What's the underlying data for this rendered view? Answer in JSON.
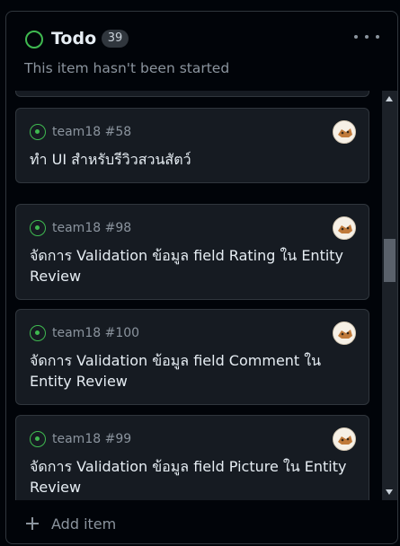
{
  "column": {
    "title": "Todo",
    "count": "39",
    "subtitle": "This item hasn't been started"
  },
  "cards": [
    {
      "meta": "team18 #58",
      "title": "ทำ UI สำหรับรีวิวสวนสัตว์"
    },
    {
      "meta": "team18 #98",
      "title": "จัดการ Validation ข้อมูล field Rating ใน Entity Review"
    },
    {
      "meta": "team18 #100",
      "title": "จัดการ Validation ข้อมูล field Comment ใน Entity Review"
    },
    {
      "meta": "team18 #99",
      "title": "จัดการ Validation ข้อมูล field Picture ใน Entity Review"
    }
  ],
  "footer": {
    "add_label": "Add item"
  },
  "colors": {
    "accent_green": "#3fb950",
    "background": "#010409",
    "card": "#161b22",
    "border": "#30363d"
  },
  "icons": {
    "status": "open-circle-icon",
    "issue": "issue-opened-icon",
    "more": "kebab-horizontal-icon",
    "add": "plus-icon"
  }
}
